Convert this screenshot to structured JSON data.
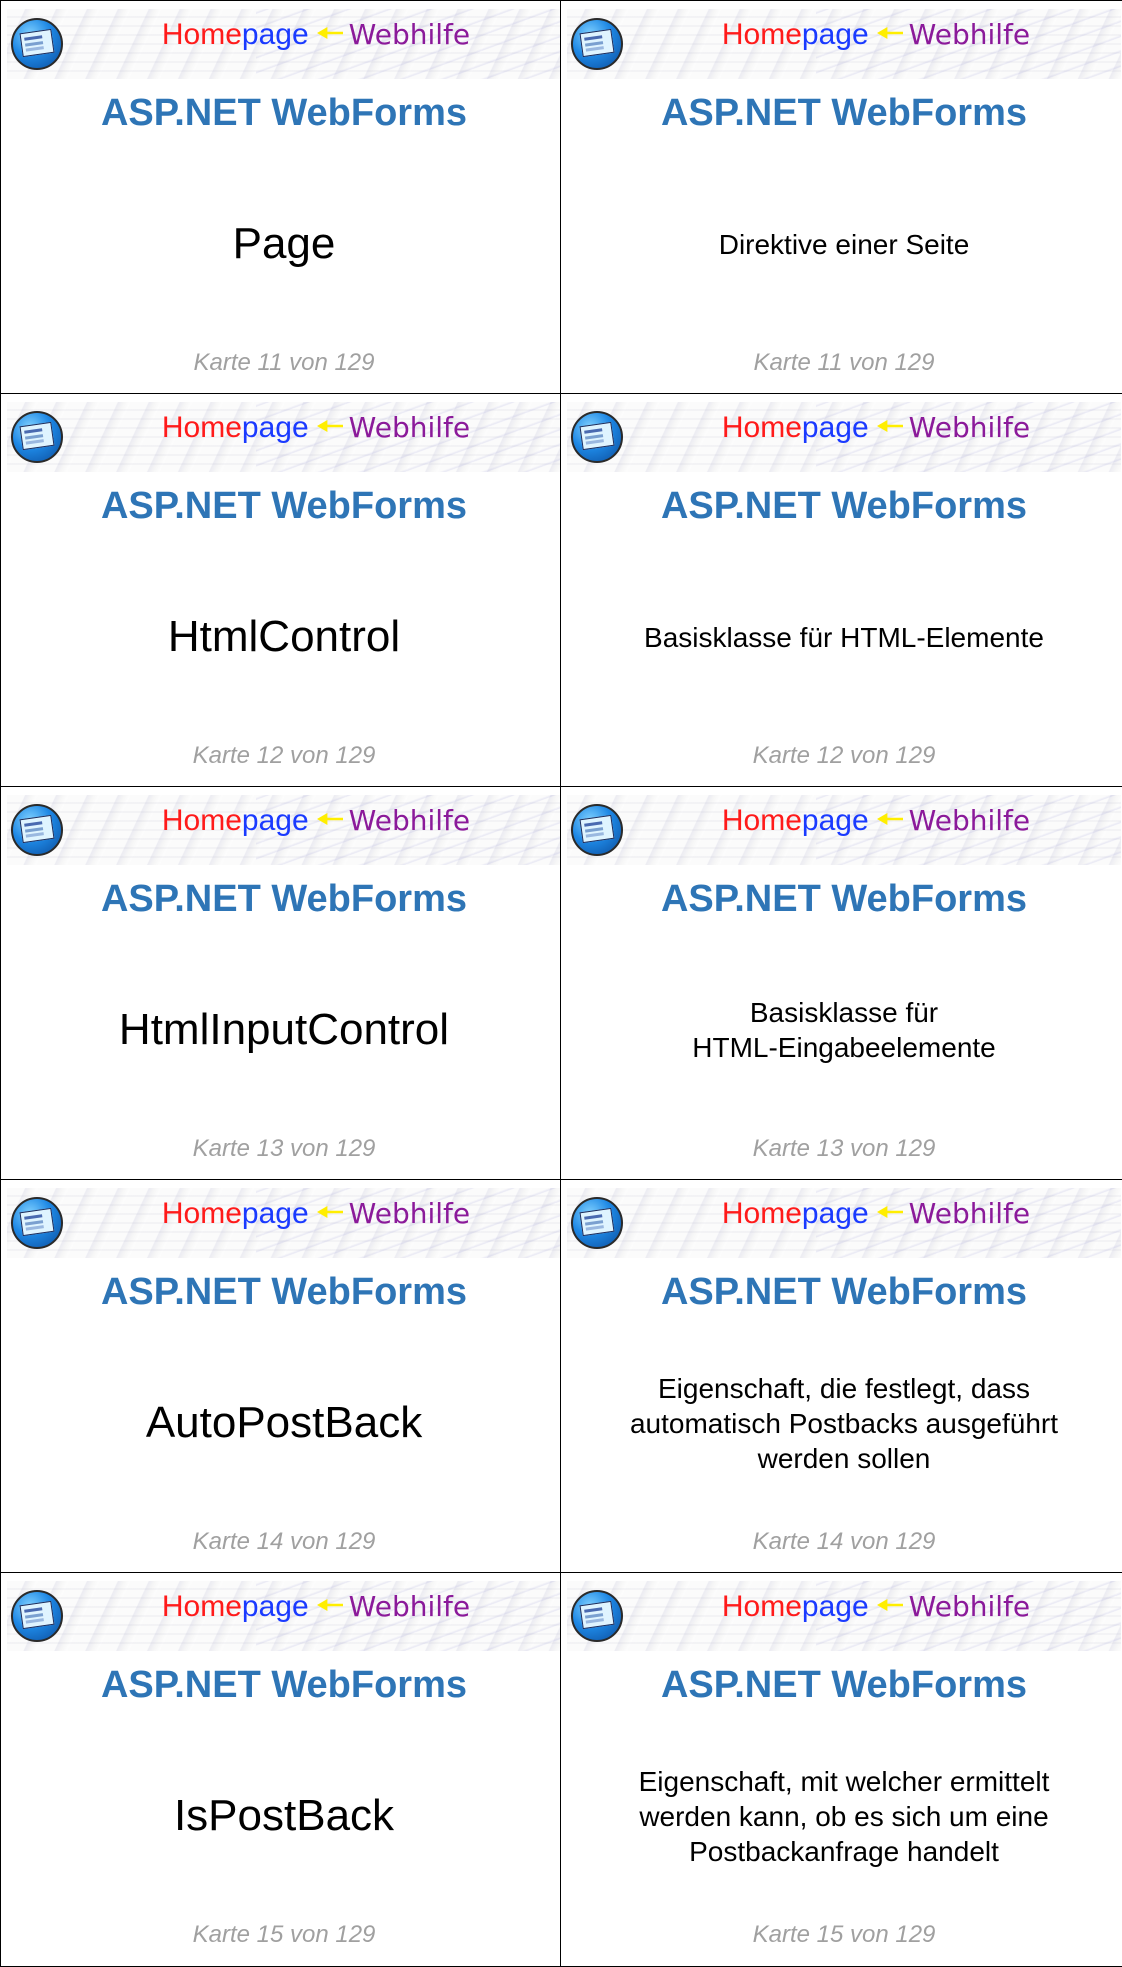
{
  "brand": {
    "part1": "Home",
    "part2": "page",
    "part3": "Webhilfe"
  },
  "deck_title": "ASP.NET WebForms",
  "cards": [
    {
      "front": "Page",
      "back": "Direktive einer Seite",
      "footer": "Karte 11 von 129"
    },
    {
      "front": "HtmlControl",
      "back": "Basisklasse für HTML-Elemente",
      "footer": "Karte 12 von 129"
    },
    {
      "front": "HtmlInputControl",
      "back": "Basisklasse für\nHTML-Eingabeelemente",
      "footer": "Karte 13 von 129"
    },
    {
      "front": "AutoPostBack",
      "back": "Eigenschaft, die festlegt, dass\nautomatisch Postbacks ausgeführt\nwerden sollen",
      "footer": "Karte 14 von 129"
    },
    {
      "front": "IsPostBack",
      "back": "Eigenschaft, mit welcher ermittelt\nwerden kann, ob es sich um eine\nPostbackanfrage handelt",
      "footer": "Karte 15 von 129"
    }
  ]
}
